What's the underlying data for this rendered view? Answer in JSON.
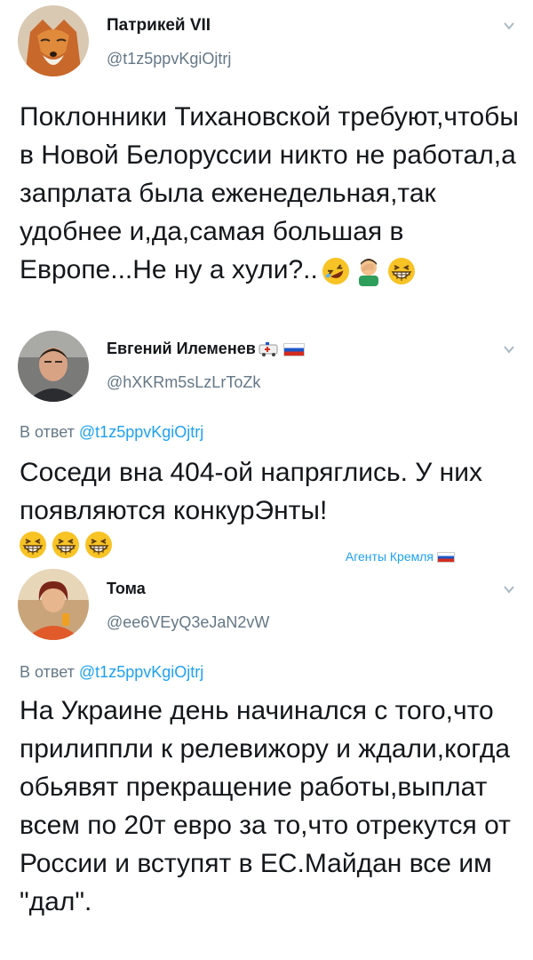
{
  "tweets": [
    {
      "name": "Патрикей VII",
      "handle": "@t1z5ppvKgiOjtrj",
      "text": "Поклонники Тихановской требуют,чтобы в Новой Белоруссии никто не работал,а запрлата была еженедельная,так удобнее и,да,самая большая в Европе...Не ну а хули?..",
      "emojis": [
        "rolling-laughing-face-icon",
        "facepalm-icon",
        "grinning-squinting-face-icon"
      ]
    },
    {
      "name": "Евгений Илеменев",
      "handle": "@hXKRm5sLzLrToZk",
      "reply_prefix": "В ответ",
      "reply_to": "@t1z5ppvKgiOjtrj",
      "text": "Соседи вна 404-ой напряглись. У них появляются конкурЭнты!",
      "emojis": [
        "grinning-squinting-face-icon",
        "grinning-squinting-face-icon",
        "grinning-squinting-face-icon"
      ],
      "tag": "Агенты Кремля"
    },
    {
      "name": "Тома",
      "handle": "@ee6VEyQ3eJaN2vW",
      "reply_prefix": "В ответ",
      "reply_to": "@t1z5ppvKgiOjtrj",
      "text": "На Украине день начинался с того,что прилиппли к релевижору и ждали,когда обьявят прекращение работы,выплат всем по 20т евро за то,что отрекутся от России и вступят в ЕС.Майдан все им \"дал\"."
    }
  ],
  "colors": {
    "accent": "#1da1f2",
    "secondary_text": "#657786",
    "primary_text": "#14171a",
    "flag_white": "#ffffff",
    "flag_blue": "#1c57c8",
    "flag_red": "#d52b1e"
  }
}
